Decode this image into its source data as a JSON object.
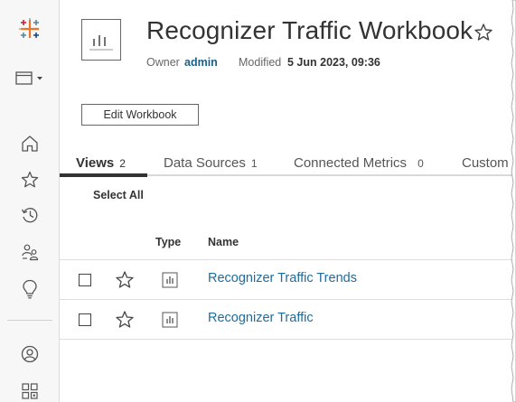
{
  "sidebar": {
    "items": [
      {
        "name": "tableau-logo-icon"
      },
      {
        "name": "site-menu-icon"
      },
      {
        "name": "home-icon"
      },
      {
        "name": "favorites-icon"
      },
      {
        "name": "recents-icon"
      },
      {
        "name": "shared-with-me-icon"
      },
      {
        "name": "recommendations-icon"
      },
      {
        "name": "user-profile-icon"
      },
      {
        "name": "apps-grid-icon"
      }
    ]
  },
  "header": {
    "title": "Recognizer Traffic Workbook",
    "owner_label": "Owner",
    "owner_value": "admin",
    "modified_label": "Modified",
    "modified_value": "5 Jun 2023, 09:36",
    "edit_button": "Edit Workbook"
  },
  "tabs": [
    {
      "label": "Views",
      "count": "2",
      "active": true
    },
    {
      "label": "Data Sources",
      "count": "1",
      "active": false
    },
    {
      "label": "Connected Metrics",
      "count": "0",
      "active": false
    },
    {
      "label": "Custom",
      "count": "",
      "active": false
    }
  ],
  "toolbar": {
    "select_all": "Select All"
  },
  "table": {
    "columns": {
      "type": "Type",
      "name": "Name"
    },
    "rows": [
      {
        "name": "Recognizer Traffic Trends",
        "type_icon": "view-chart-icon",
        "selected": false,
        "favorite": false
      },
      {
        "name": "Recognizer Traffic",
        "type_icon": "view-chart-icon",
        "selected": false,
        "favorite": false
      }
    ]
  },
  "colors": {
    "link": "#1f6c9c",
    "owner_link": "#1f5f86",
    "sidebar_bg": "#f7f7f7",
    "active_tab_underline": "#333333"
  }
}
